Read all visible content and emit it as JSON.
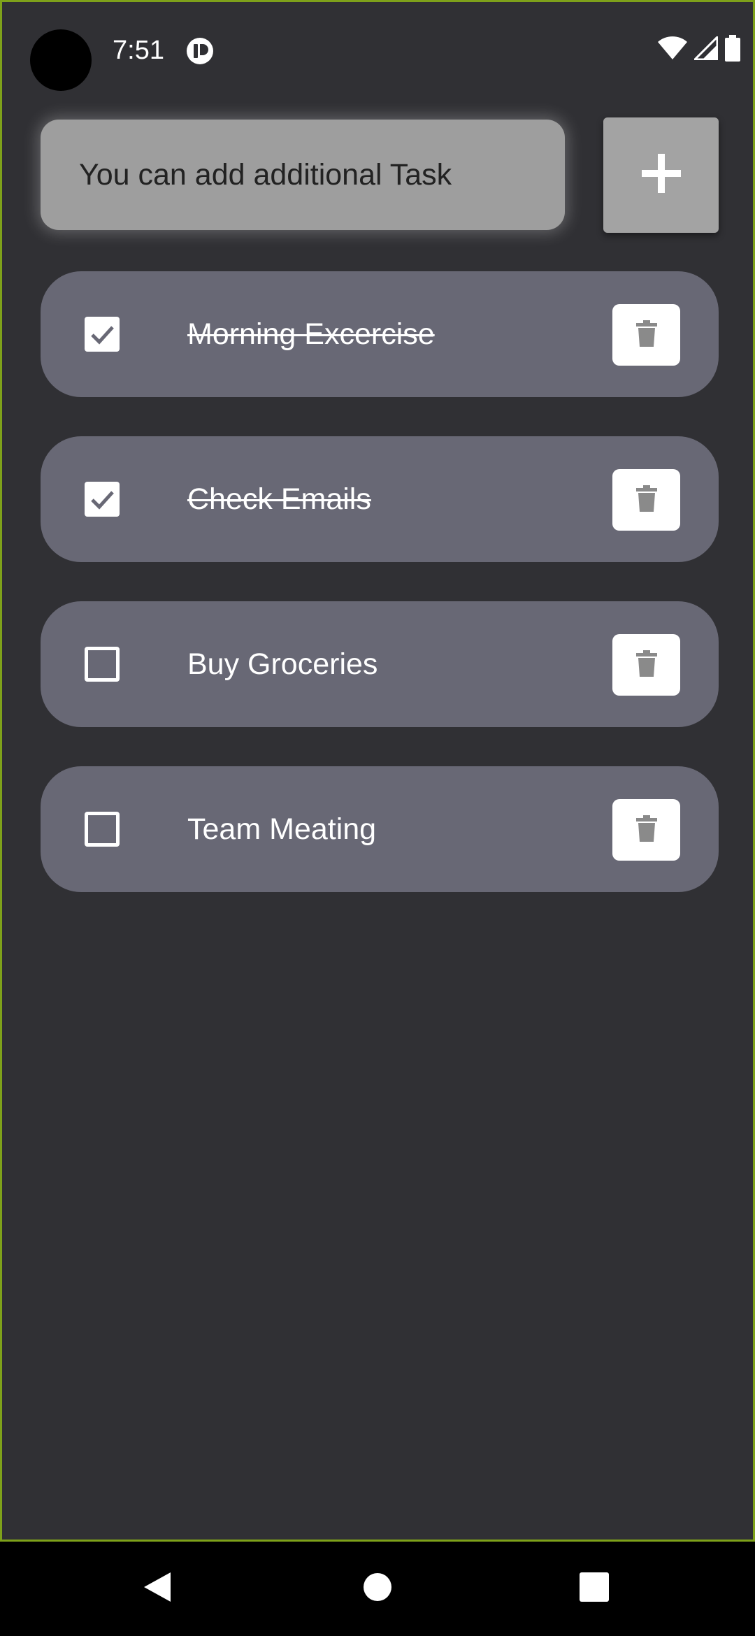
{
  "status_bar": {
    "time": "7:51",
    "icons": [
      "app-notification-icon",
      "wifi-icon",
      "cell-signal-icon",
      "battery-icon"
    ]
  },
  "input": {
    "placeholder": "You can add additional Task",
    "value": ""
  },
  "add_button": {
    "icon": "plus-icon"
  },
  "tasks": [
    {
      "label": "Morning Excercise",
      "checked": true
    },
    {
      "label": "Check Emails",
      "checked": true
    },
    {
      "label": "Buy Groceries",
      "checked": false
    },
    {
      "label": "Team Meating",
      "checked": false
    }
  ],
  "colors": {
    "background": "#303034",
    "card": "#686875",
    "input": "#9e9e9e",
    "add_button": "#a3a3a3",
    "frame_border": "#7ea11a"
  },
  "nav": {
    "buttons": [
      "back-icon",
      "home-icon",
      "recents-icon"
    ]
  }
}
